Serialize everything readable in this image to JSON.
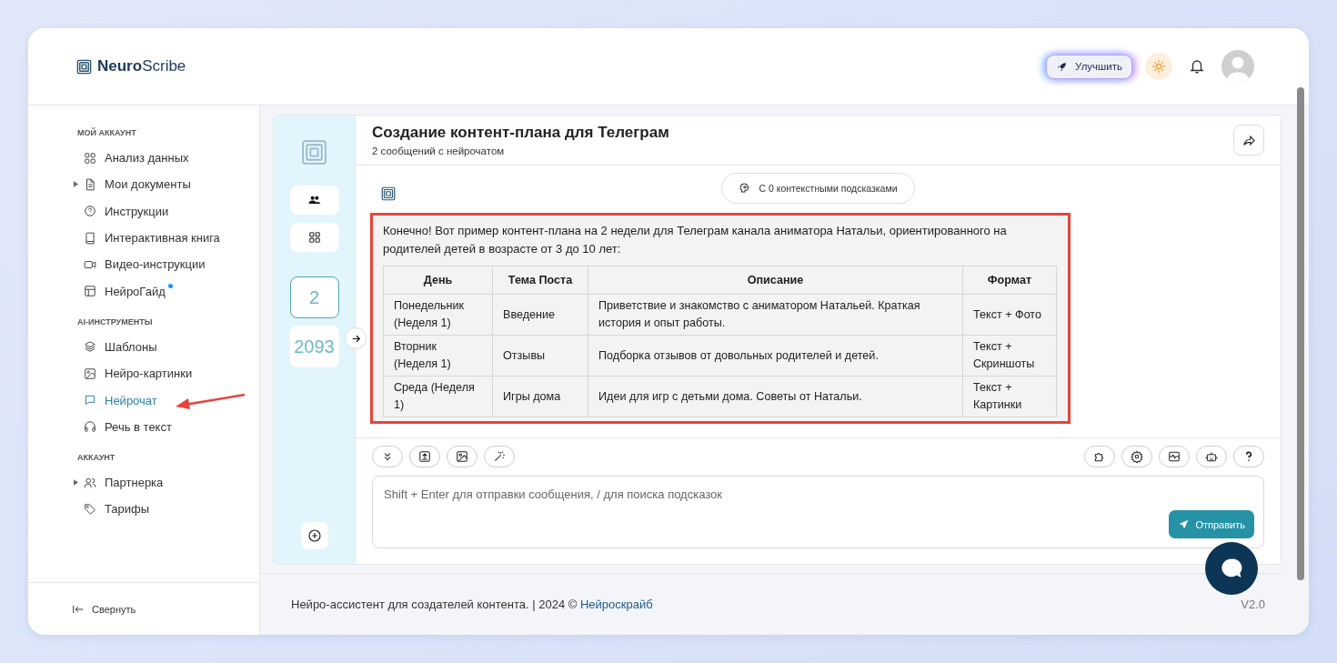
{
  "brand": {
    "bold": "Neuro",
    "light": "Scribe"
  },
  "header": {
    "upgrade": "Улучшить"
  },
  "sidebar": {
    "sections": [
      {
        "title": "МОЙ АККАУНТ",
        "items": [
          {
            "label": "Анализ данных",
            "selected": false,
            "expandable": false,
            "dot": false
          },
          {
            "label": "Мои документы",
            "selected": false,
            "expandable": true,
            "dot": false
          },
          {
            "label": "Инструкции",
            "selected": false,
            "expandable": false,
            "dot": false
          },
          {
            "label": "Интерактивная книга",
            "selected": false,
            "expandable": false,
            "dot": false
          },
          {
            "label": "Видео-инструкции",
            "selected": false,
            "expandable": false,
            "dot": false
          },
          {
            "label": "НейроГайд",
            "selected": false,
            "expandable": false,
            "dot": true
          }
        ]
      },
      {
        "title": "AI-ИНСТРУМЕНТЫ",
        "items": [
          {
            "label": "Шаблоны",
            "selected": false,
            "expandable": false,
            "dot": false
          },
          {
            "label": "Нейро-картинки",
            "selected": false,
            "expandable": false,
            "dot": false
          },
          {
            "label": "Нейрочат",
            "selected": true,
            "expandable": false,
            "dot": false
          },
          {
            "label": "Речь в текст",
            "selected": false,
            "expandable": false,
            "dot": false
          }
        ]
      },
      {
        "title": "АККАУНТ",
        "items": [
          {
            "label": "Партнерка",
            "selected": false,
            "expandable": true,
            "dot": false
          },
          {
            "label": "Тарифы",
            "selected": false,
            "expandable": false,
            "dot": false
          }
        ]
      }
    ],
    "collapse": "Свернуть"
  },
  "rail": {
    "counters": [
      {
        "value": "2",
        "selected": true
      },
      {
        "value": "2093",
        "selected": false
      }
    ]
  },
  "chat": {
    "title": "Создание контент-плана для Телеграм",
    "subtitle": "2 сообщений с нейрочатом",
    "context_hint": "С 0 контекстными подсказками",
    "message": {
      "intro": "Конечно! Вот пример контент-плана на 2 недели для Телеграм канала аниматора Натальи, ориентированного на родителей детей в возрасте от 3 до 10 лет:",
      "table": {
        "columns": [
          "День",
          "Тема Поста",
          "Описание",
          "Формат"
        ],
        "rows": [
          [
            "Понедельник (Неделя 1)",
            "Введение",
            "Приветствие и знакомство с аниматором Натальей. Краткая история и опыт работы.",
            "Текст + Фото"
          ],
          [
            "Вторник (Неделя 1)",
            "Отзывы",
            "Подборка отзывов от довольных родителей и детей.",
            "Текст + Скриншоты"
          ],
          [
            "Среда (Неделя 1)",
            "Игры дома",
            "Идеи для игр с детьми дома. Советы от Натальи.",
            "Текст + Картинки"
          ]
        ]
      }
    },
    "input": {
      "placeholder": "Shift + Enter для отправки сообщения, / для поиска подсказок"
    },
    "send": "Отправить"
  },
  "footer": {
    "text": "Нейро-ассистент для создателей контента.  | 2024 ©",
    "link": "Нейроскрайб",
    "version": "V2.0"
  }
}
